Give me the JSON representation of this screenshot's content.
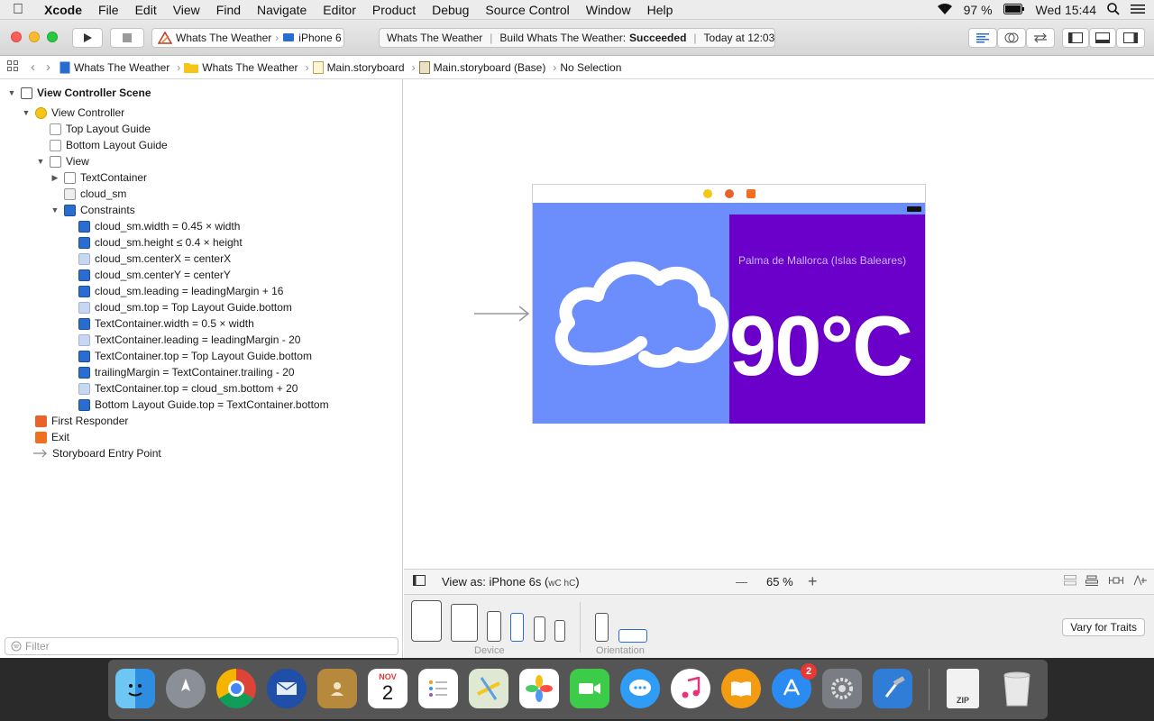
{
  "menubar": {
    "app": "Xcode",
    "items": [
      "File",
      "Edit",
      "View",
      "Find",
      "Navigate",
      "Editor",
      "Product",
      "Debug",
      "Source Control",
      "Window",
      "Help"
    ],
    "battery": "97 %",
    "clock": "Wed 15:44"
  },
  "toolbar": {
    "scheme": "Whats The Weather",
    "device": "iPhone 6",
    "activity": {
      "project": "Whats The Weather",
      "build_prefix": "Build Whats The Weather:",
      "build_status": "Succeeded",
      "time": "Today at 12:03"
    }
  },
  "jumpbar": {
    "crumbs": [
      "Whats The Weather",
      "Whats The Weather",
      "Main.storyboard",
      "Main.storyboard (Base)",
      "No Selection"
    ]
  },
  "outline": {
    "scene": "View Controller Scene",
    "view_controller": "View Controller",
    "top_guide": "Top Layout Guide",
    "bottom_guide": "Bottom Layout Guide",
    "view": "View",
    "text_container": "TextContainer",
    "cloud": "cloud_sm",
    "constraints_label": "Constraints",
    "constraints": [
      "cloud_sm.width = 0.45 × width",
      "cloud_sm.height ≤ 0.4 × height",
      "cloud_sm.centerX = centerX",
      "cloud_sm.centerY = centerY",
      "cloud_sm.leading = leadingMargin + 16",
      "cloud_sm.top = Top Layout Guide.bottom",
      "TextContainer.width = 0.5 × width",
      "TextContainer.leading = leadingMargin - 20",
      "TextContainer.top = Top Layout Guide.bottom",
      "trailingMargin = TextContainer.trailing - 20",
      "TextContainer.top = cloud_sm.bottom + 20",
      "Bottom Layout Guide.top = TextContainer.bottom"
    ],
    "first_responder": "First Responder",
    "exit": "Exit",
    "entry_point": "Storyboard Entry Point",
    "filter_placeholder": "Filter"
  },
  "canvas": {
    "location": "Palma de Mallorca (Islas Baleares)",
    "temperature": "90°C"
  },
  "bottombar": {
    "view_as": "View as: iPhone 6s (",
    "view_as_traits": "wC hC",
    "view_as_end": ")",
    "zoom_minus": "—",
    "zoom": "65 %",
    "zoom_plus": "+"
  },
  "devicebar": {
    "device_label": "Device",
    "orientation_label": "Orientation",
    "vary_button": "Vary for Traits"
  },
  "dock": {
    "calendar_month": "NOV",
    "calendar_day": "2",
    "appstore_badge": "2",
    "zip_label": "ZIP"
  },
  "colors": {
    "screen_bg": "#6b8efc",
    "text_container_bg": "#6a00c9",
    "accent": "#2a6ccf"
  }
}
